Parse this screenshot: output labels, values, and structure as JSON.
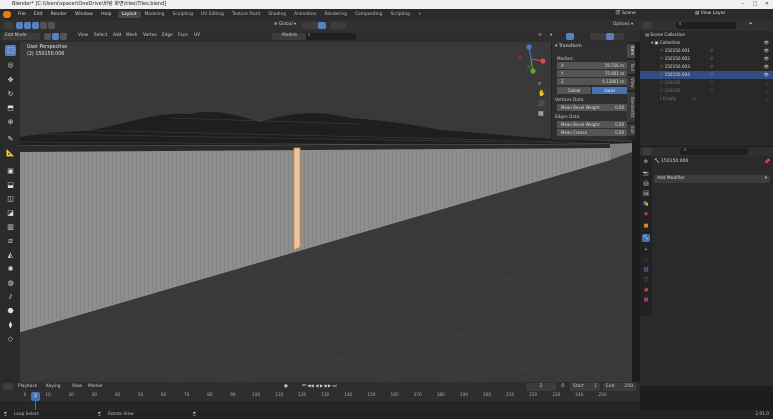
{
  "window": {
    "title": "Blender* [C:\\Users\\spacer\\OneDrive\\바탕 화면\\tiles\\Tiles.blend]"
  },
  "topbar": {
    "menus": [
      "File",
      "Edit",
      "Render",
      "Window",
      "Help"
    ],
    "workspaces": [
      "Layout",
      "Modeling",
      "Sculpting",
      "UV Editing",
      "Texture Paint",
      "Shading",
      "Animation",
      "Rendering",
      "Compositing",
      "Scripting"
    ],
    "active_workspace": "Layout",
    "add_tab": "+",
    "scene_label": "Scene",
    "view_layer_label": "View Layer"
  },
  "viewport_header": {
    "orientation": "Global",
    "snapping_mode": "Models",
    "options_label": "Options"
  },
  "tool_header": {
    "mode": "Edit Mode",
    "menus": [
      "View",
      "Select",
      "Add",
      "Mesh",
      "Vertex",
      "Edge",
      "Face",
      "UV"
    ]
  },
  "viewport": {
    "view_name": "User Perspective",
    "object_info": "(2) 150150.006",
    "axis_x": "X",
    "axis_y": "Y",
    "axis_z": "Z"
  },
  "npanel": {
    "header": "Transform",
    "median_label": "Median:",
    "x_label": "X",
    "x_value": "59.556 m",
    "y_label": "Y",
    "y_value": "-75.801 m",
    "z_label": "Z",
    "z_value": "0.12861 m",
    "space_global": "Global",
    "space_local": "Local",
    "vertices_data": "Vertices Data:",
    "mean_bevel_weight_v": "Mean Bevel Weight",
    "mean_bevel_weight_v_val": "0.00",
    "edges_data": "Edges Data:",
    "mean_bevel_weight_e": "Mean Bevel Weight",
    "mean_bevel_weight_e_val": "0.00",
    "mean_crease": "Mean Crease",
    "mean_crease_val": "0.00",
    "tabs": [
      "Item",
      "Tool",
      "View",
      "BlenderKit",
      "Edit"
    ]
  },
  "outliner": {
    "scene_collection": "Scene Collection",
    "collection": "Collection",
    "items": [
      {
        "name": "150150.001",
        "selected": false
      },
      {
        "name": "150150.002",
        "selected": false
      },
      {
        "name": "150150.003",
        "selected": false
      },
      {
        "name": "150150.004",
        "selected": true
      },
      {
        "name": "150150",
        "selected": false
      },
      {
        "name": "150150",
        "selected": false
      },
      {
        "name": "Empty",
        "selected": false
      }
    ]
  },
  "properties": {
    "object_name": "150150.006",
    "add_modifier": "Add Modifier"
  },
  "timeline": {
    "menus": [
      "Playback",
      "Keying",
      "View",
      "Marker"
    ],
    "current_frame": "2",
    "start_label": "Start",
    "start_value": "1",
    "end_label": "End",
    "end_value": "250",
    "ticks": [
      "0",
      "10",
      "20",
      "30",
      "40",
      "50",
      "60",
      "70",
      "80",
      "90",
      "100",
      "110",
      "120",
      "130",
      "140",
      "150",
      "160",
      "170",
      "180",
      "190",
      "200",
      "210",
      "220",
      "230",
      "240",
      "250"
    ]
  },
  "statusbar": {
    "left_action": "Loop Select",
    "mid_action": "Rotate View",
    "version": "2.91.0"
  },
  "colors": {
    "accent_blue": "#4772b3",
    "selected_row": "#334d80",
    "orange_mesh": "#e08a36"
  }
}
